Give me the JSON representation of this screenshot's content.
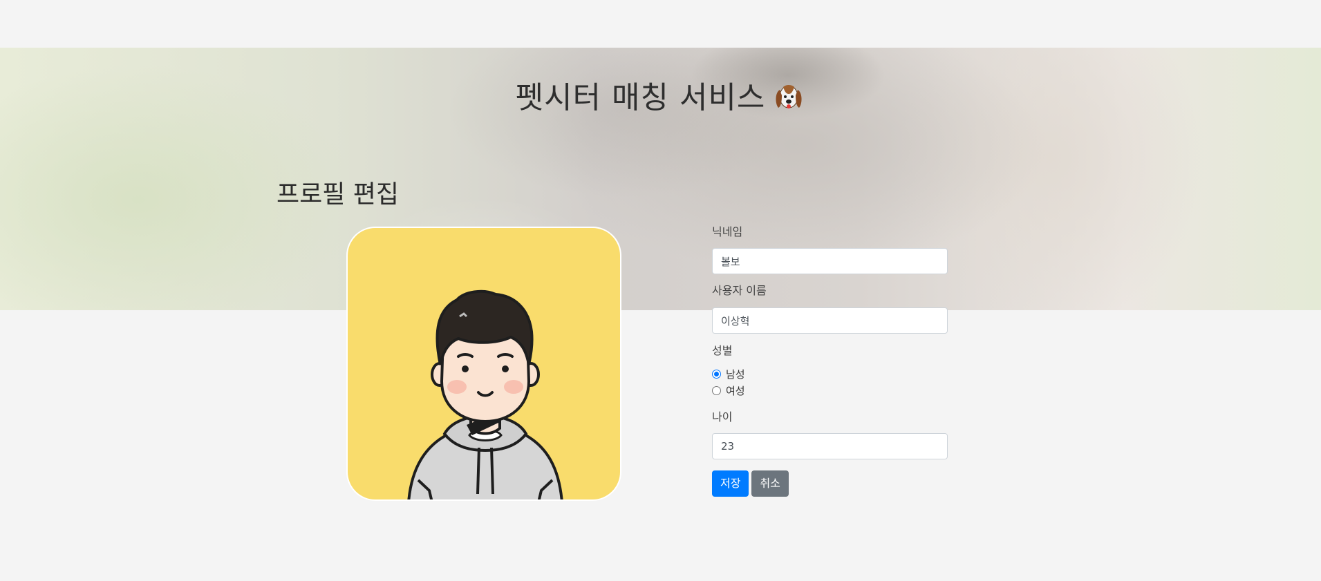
{
  "header": {
    "site_title": "펫시터 매칭 서비스"
  },
  "profile": {
    "section_title": "프로필 편집",
    "avatar_icon": "cartoon-person-avatar",
    "nickname_label": "닉네임",
    "nickname_value": "볼보",
    "username_label": "사용자 이름",
    "username_value": "이상혁",
    "gender_label": "성별",
    "gender_options": [
      "남성",
      "여성"
    ],
    "gender_selected": "남성",
    "age_label": "나이",
    "age_value": "23",
    "save_label": "저장",
    "cancel_label": "취소"
  },
  "colors": {
    "primary": "#007bff",
    "secondary": "#6c757d",
    "avatar_bg": "#f9dc6c",
    "page_bg": "#f4f4f4"
  }
}
